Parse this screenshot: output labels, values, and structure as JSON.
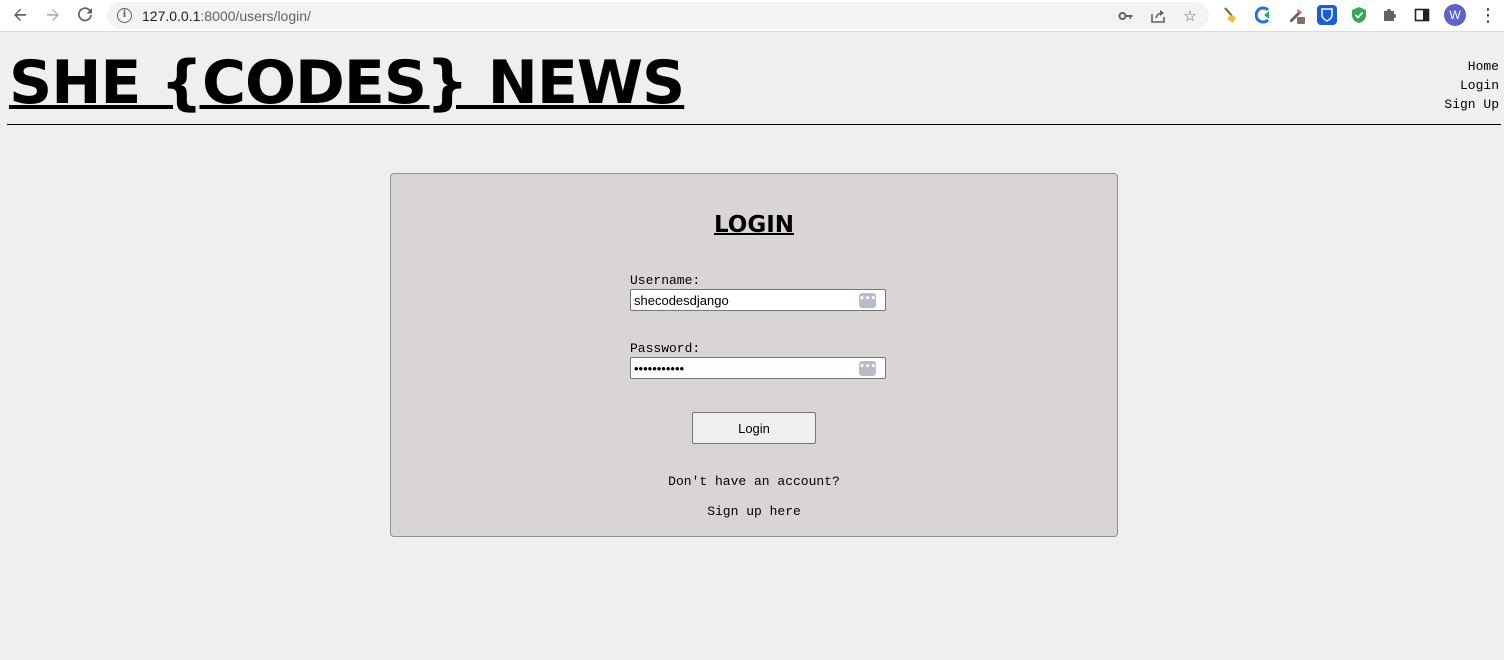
{
  "browser": {
    "url_host": "127.0.0.1",
    "url_path": ":8000/users/login/",
    "profile_initial": "W",
    "icons": {
      "back": "arrow-left-icon",
      "forward": "arrow-right-icon",
      "reload": "reload-icon",
      "info": "info-icon",
      "key": "key-icon",
      "share": "share-icon",
      "bookmark": "star-icon",
      "extensions": "puzzle-icon",
      "side_panel": "side-panel-icon",
      "menu": "kebab-menu-icon"
    }
  },
  "header": {
    "site_title": "SHE {CODES} NEWS",
    "nav": [
      "Home",
      "Login",
      "Sign Up"
    ]
  },
  "login": {
    "title": "LOGIN",
    "username_label": "Username:",
    "username_value": "shecodesdjango",
    "password_label": "Password:",
    "password_value": "•••••••••••",
    "submit_label": "Login",
    "no_account_text": "Don't have an account?",
    "signup_link": "Sign up here"
  },
  "colors": {
    "page_bg": "#efefef",
    "card_bg": "#d9d5d4",
    "text": "#000000"
  }
}
